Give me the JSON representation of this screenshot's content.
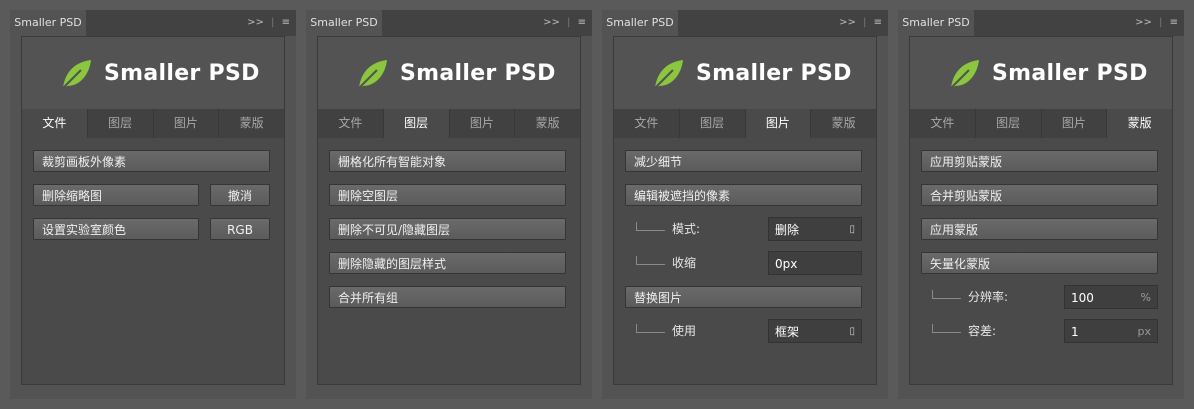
{
  "panel_tab_title": "Smaller PSD",
  "panel_controls": {
    "collapse": ">>",
    "menu": "≡"
  },
  "app_name": "Smaller PSD",
  "tabs": [
    "文件",
    "图层",
    "图片",
    "蒙版"
  ],
  "panels": [
    {
      "active_tab": 0,
      "file": {
        "crop_outside": "裁剪画板外像素",
        "delete_thumb": "删除缩略图",
        "undo": "撤消",
        "set_lab": "设置实验室颜色",
        "rgb": "RGB"
      }
    },
    {
      "active_tab": 1,
      "layer": {
        "rasterize": "栅格化所有智能对象",
        "delete_empty": "删除空图层",
        "delete_hidden": "删除不可见/隐藏图层",
        "delete_hidden_styles": "删除隐藏的图层样式",
        "merge_groups": "合并所有组"
      }
    },
    {
      "active_tab": 2,
      "image": {
        "reduce_detail": "减少细节",
        "edit_obscured": "编辑被遮挡的像素",
        "mode_label": "模式:",
        "mode_value": "删除",
        "shrink_label": "收缩",
        "shrink_value": "0px",
        "replace_image": "替换图片",
        "use_label": "使用",
        "use_value": "框架"
      }
    },
    {
      "active_tab": 3,
      "mask": {
        "apply_clip": "应用剪贴蒙版",
        "merge_clip": "合并剪贴蒙版",
        "apply_mask": "应用蒙版",
        "vectorize": "矢量化蒙版",
        "res_label": "分辨率:",
        "res_value": "100",
        "res_unit": "%",
        "tol_label": "容差:",
        "tol_value": "1",
        "tol_unit": "px"
      }
    }
  ],
  "colors": {
    "leaf_green": "#8cc63f",
    "panel_bg": "#535353"
  }
}
